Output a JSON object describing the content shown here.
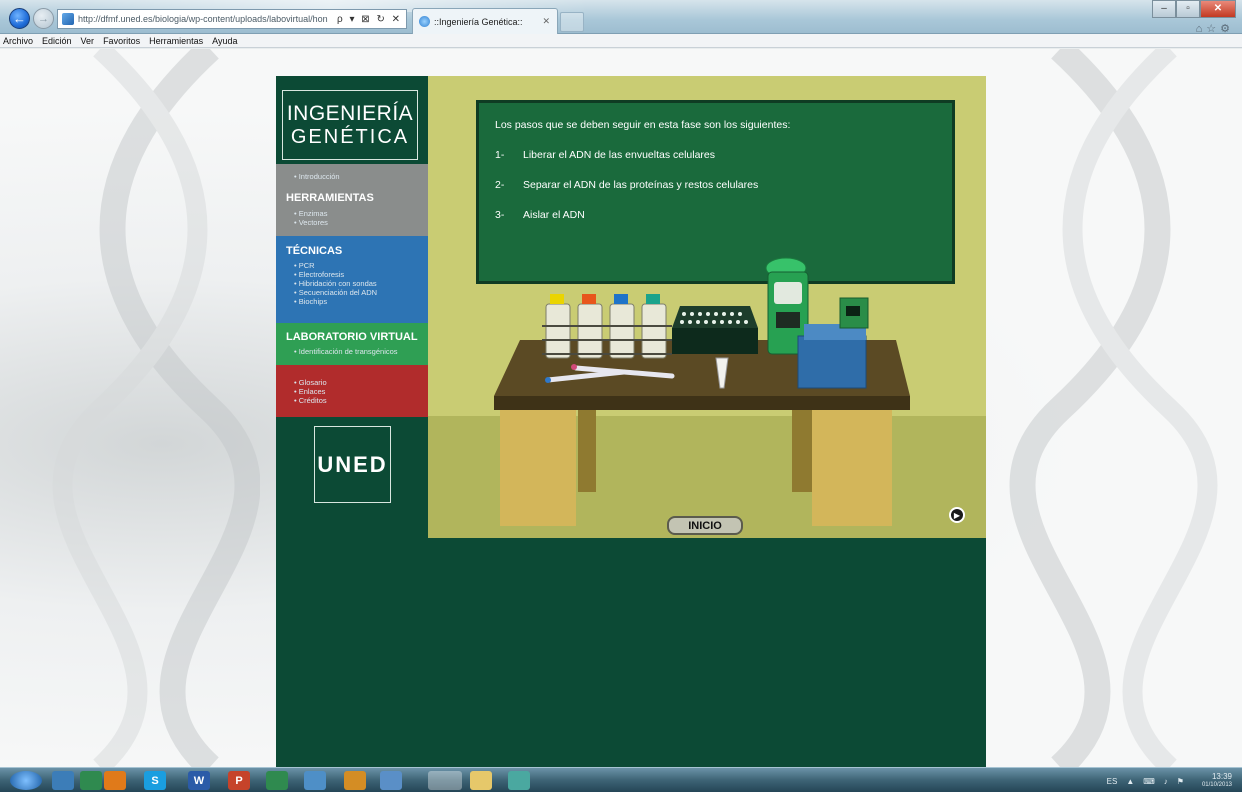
{
  "browser": {
    "url": "http://dfmf.uned.es/biologia/wp-content/uploads/labovirtual/hon",
    "url_controls": "ρ ▾ ⊠ ↻ ✕",
    "tab_title": "::Ingeniería Genética::",
    "menu": [
      "Archivo",
      "Edición",
      "Ver",
      "Favoritos",
      "Herramientas",
      "Ayuda"
    ]
  },
  "sidebar": {
    "logo_line1": "INGENIERÍA",
    "logo_line2": "GENÉTICA",
    "intro": "Introducción",
    "herramientas": {
      "title": "HERRAMIENTAS",
      "items": [
        "Enzimas",
        "Vectores"
      ]
    },
    "tecnicas": {
      "title": "TÉCNICAS",
      "items": [
        "PCR",
        "Electroforesis",
        "Hibridación con sondas",
        "Secuenciación del ADN",
        "Biochips"
      ]
    },
    "laboratorio": {
      "title": "LABORATORIO VIRTUAL",
      "items": [
        "Identificación de transgénicos"
      ]
    },
    "extra": {
      "items": [
        "Glosario",
        "Enlaces",
        "Créditos"
      ]
    },
    "uned": "UNED"
  },
  "board": {
    "intro": "Los pasos que se deben seguir en esta fase son los siguientes:",
    "steps": [
      {
        "num": "1-",
        "text": "Liberar el ADN de las envueltas celulares"
      },
      {
        "num": "2-",
        "text": "Separar el ADN de las proteínas y restos celulares"
      },
      {
        "num": "3-",
        "text": "Aislar el ADN"
      }
    ]
  },
  "controls": {
    "inicio": "INICIO"
  },
  "taskbar": {
    "lang": "ES",
    "time": "13:39",
    "date": "01/10/2013"
  },
  "colors": {
    "page_bg": "#0c4a35",
    "herramientas": "#8a8d8c",
    "tecnicas": "#2d74b4",
    "laboratorio": "#2f9f54",
    "extra": "#b12c2c",
    "board": "#1a6a3c"
  }
}
